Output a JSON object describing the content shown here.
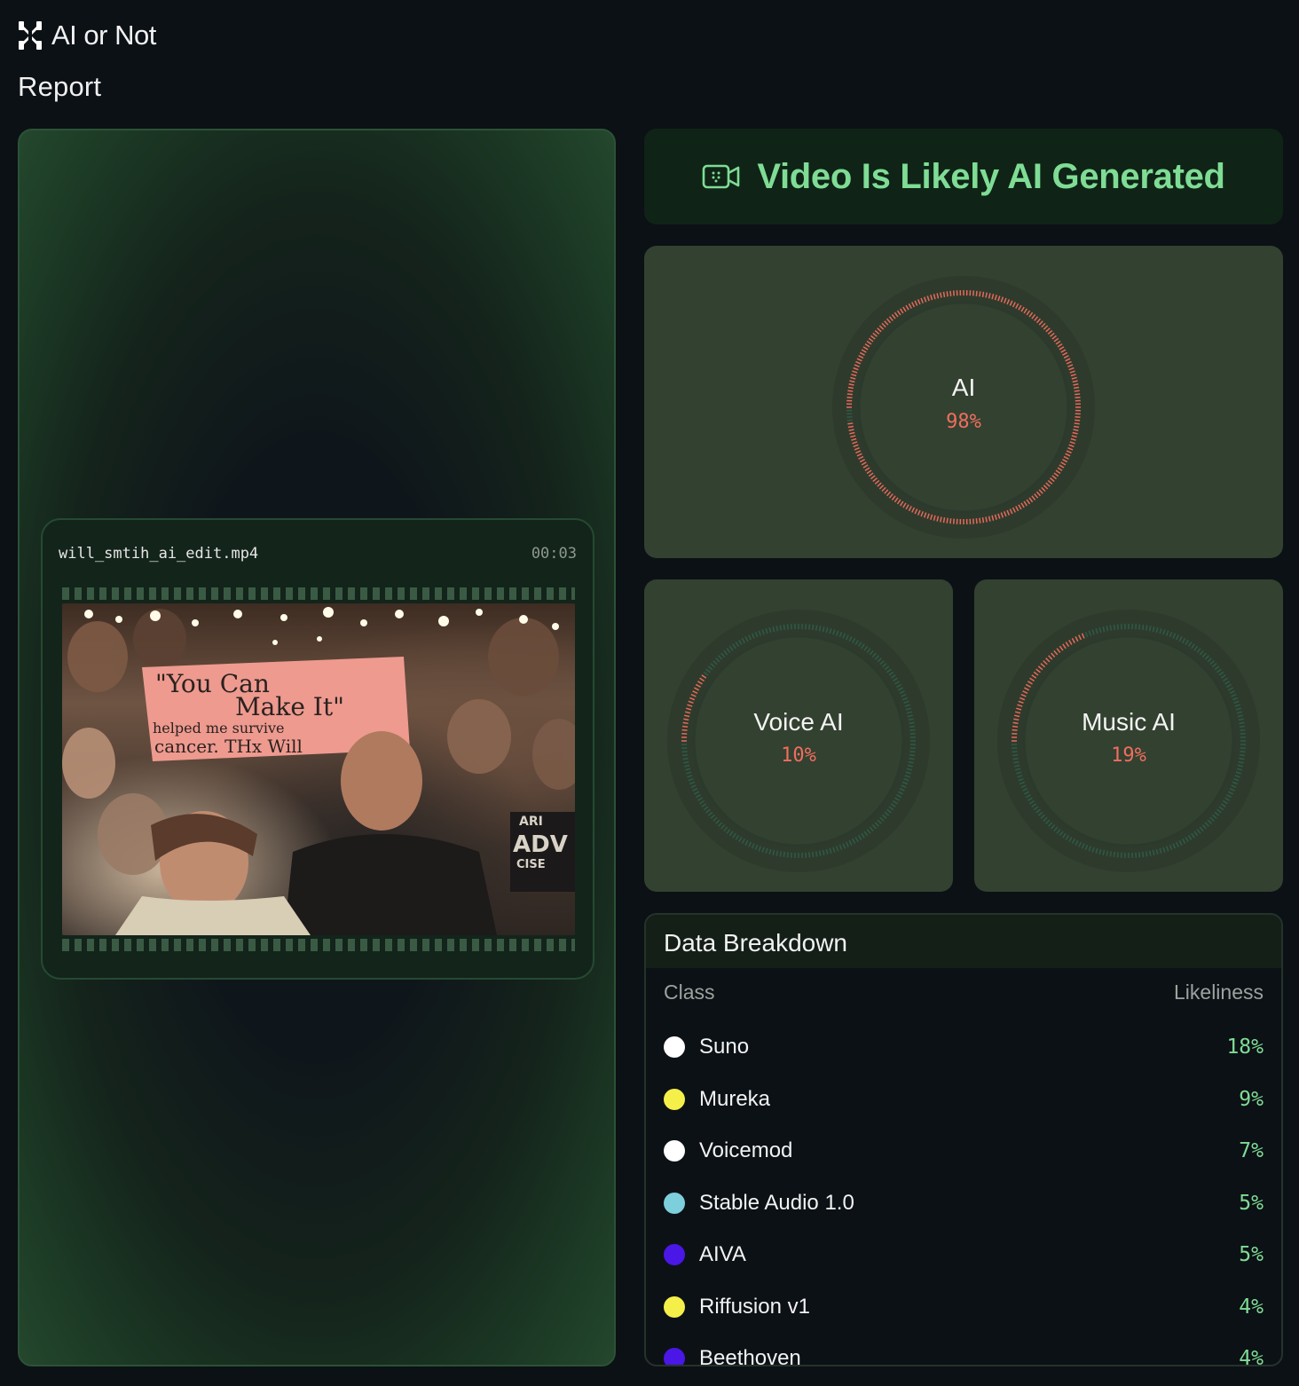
{
  "app": {
    "name": "AI or Not"
  },
  "page": {
    "title": "Report"
  },
  "media": {
    "file_name": "will_smtih_ai_edit.mp4",
    "duration": "00:03",
    "sign": {
      "line1": "\"You Can",
      "line2": "Make It\"",
      "line3": "helped me survive",
      "line4": "cancer. THx Will"
    },
    "shirt": {
      "line1": "ARI",
      "line2": "ADV",
      "line3": "CISE"
    }
  },
  "verdict": {
    "text": "Video Is Likely AI Generated",
    "icon": "video-camera-icon",
    "color": "#7fdc95"
  },
  "gauges": {
    "ai": {
      "label": "AI",
      "value": "98%",
      "fraction": 0.98
    },
    "voice": {
      "label": "Voice AI",
      "value": "10%",
      "fraction": 0.1
    },
    "music": {
      "label": "Music AI",
      "value": "19%",
      "fraction": 0.19
    },
    "fill_color": "#e8695b",
    "track_color": "#2f5a48"
  },
  "breakdown": {
    "title": "Data Breakdown",
    "col_class": "Class",
    "col_likeliness": "Likeliness",
    "rows": [
      {
        "name": "Suno",
        "value": "18%",
        "color": "#ffffff"
      },
      {
        "name": "Mureka",
        "value": "9%",
        "color": "#f5ef4a"
      },
      {
        "name": "Voicemod",
        "value": "7%",
        "color": "#ffffff"
      },
      {
        "name": "Stable Audio 1.0",
        "value": "5%",
        "color": "#7ecfdc"
      },
      {
        "name": "AIVA",
        "value": "5%",
        "color": "#4a17e6"
      },
      {
        "name": "Riffusion v1",
        "value": "4%",
        "color": "#f5ef4a"
      },
      {
        "name": "Beethoven",
        "value": "4%",
        "color": "#4a17e6"
      }
    ]
  }
}
